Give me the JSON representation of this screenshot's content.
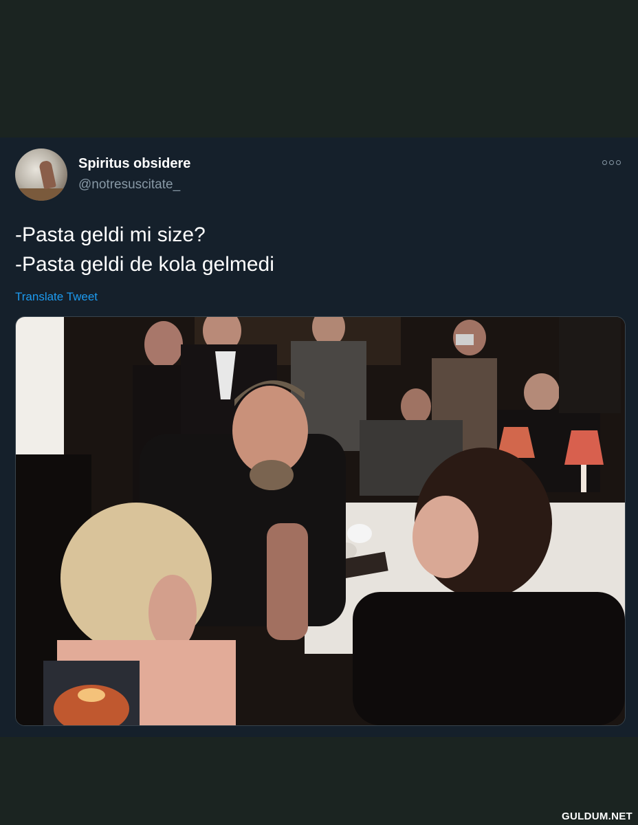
{
  "tweet": {
    "display_name": "Spiritus obsidere",
    "handle": "@notresuscitate_",
    "lines": [
      "-Pasta geldi mi size?",
      "-Pasta geldi de kola gelmedi"
    ],
    "translate_label": "Translate Tweet",
    "more_icon": "more-options-icon"
  },
  "watermark": "GULDUM.NET",
  "colors": {
    "page_background": "#1b2421",
    "tweet_background": "#15202b",
    "link": "#1d9bf0",
    "secondary_text": "#8899a6"
  }
}
